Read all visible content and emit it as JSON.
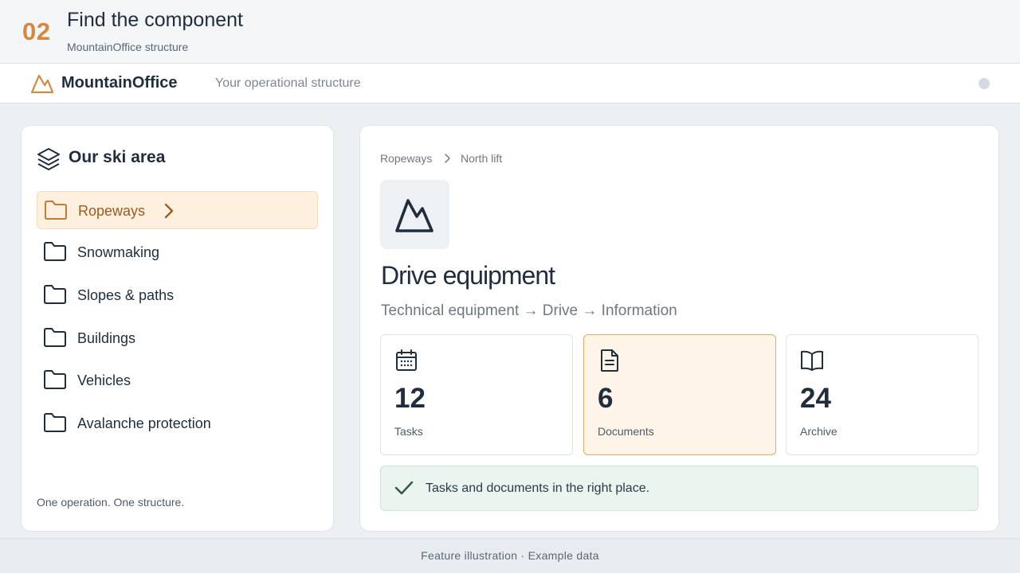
{
  "step": {
    "number": "02",
    "title": "Find the component",
    "subtitle": "MountainOffice structure"
  },
  "app": {
    "brand": "MountainOffice",
    "tagline": "Your operational structure",
    "accent": "#d4873d"
  },
  "sidebar": {
    "title": "Our ski area",
    "items": [
      {
        "label": "Ropeways",
        "active": true
      },
      {
        "label": "Snowmaking"
      },
      {
        "label": "Slopes & paths"
      },
      {
        "label": "Buildings"
      },
      {
        "label": "Vehicles"
      },
      {
        "label": "Avalanche protection"
      }
    ],
    "footer": "One operation. One structure."
  },
  "main": {
    "breadcrumb": [
      "Ropeways",
      "North lift"
    ],
    "title": "Drive equipment",
    "path": "Technical equipment → Drive → Information",
    "stats": [
      {
        "value": "12",
        "label": "Tasks",
        "icon": "calendar-icon"
      },
      {
        "value": "6",
        "label": "Documents",
        "icon": "document-icon",
        "active": true
      },
      {
        "value": "24",
        "label": "Archive",
        "icon": "book-icon"
      }
    ],
    "success_message": "Tasks and documents in the right place."
  },
  "footer": {
    "text": "Feature illustration · Example data"
  }
}
